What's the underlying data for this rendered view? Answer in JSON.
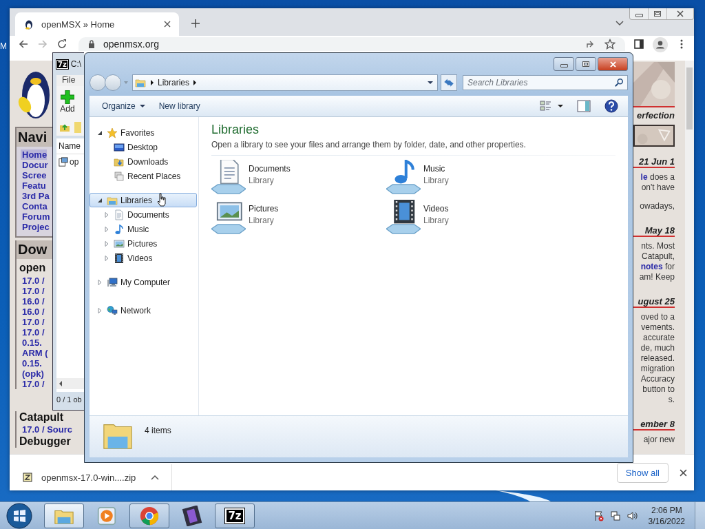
{
  "desktop": {
    "edge_text": "M"
  },
  "browser": {
    "tab": {
      "title": "openMSX » Home",
      "selected": true
    },
    "url": "openmsx.org",
    "page": {
      "nav_heading": "Navi",
      "nav_items": [
        {
          "label": "Home",
          "selected": true
        },
        {
          "label": "Docur",
          "selected": false
        },
        {
          "label": "Scree",
          "selected": false
        },
        {
          "label": "Featu",
          "selected": false
        },
        {
          "label": "3rd Pa",
          "selected": false
        },
        {
          "label": "Conta",
          "selected": false
        },
        {
          "label": "Forum",
          "selected": false
        },
        {
          "label": "Projec",
          "selected": false
        }
      ],
      "download_heading": "Dow",
      "download_subheading": "open",
      "download_links": [
        "17.0 /",
        "17.0 /",
        "16.0 /",
        "16.0 /",
        "17.0 /",
        "17.0 /",
        "0.15.",
        "ARM (",
        "0.15.",
        "(opk)",
        "17.0 /"
      ],
      "lower": [
        {
          "kind": "heading",
          "text": "Catapult"
        },
        {
          "kind": "link",
          "text": "17.0 / Sourc"
        },
        {
          "kind": "heading",
          "text": "Debugger"
        }
      ],
      "banner_text": "erfection",
      "news": [
        {
          "date": "21 Jun 1",
          "paragraphs": [
            [
              "**le** does a",
              "on't have"
            ],
            [
              "owadays,"
            ]
          ]
        },
        {
          "date": "May 18",
          "paragraphs": [
            [
              "nts. Most",
              "Catapult,",
              "**notes** for",
              "am! Keep"
            ]
          ]
        },
        {
          "date": "ugust 25",
          "paragraphs": [
            [
              "oved to a",
              "vements.",
              "accurate",
              "de, much",
              "released.",
              "migration",
              "Accuracy",
              "button to",
              "s."
            ]
          ]
        },
        {
          "date": "ember 8",
          "paragraphs": [
            [
              "ajor new"
            ]
          ]
        }
      ]
    },
    "download_bar": {
      "file": "openmsx-17.0-win....zip",
      "show_all": "Show all"
    }
  },
  "archiver": {
    "logo": "7z",
    "title": "C:\\",
    "menu": [
      "File"
    ],
    "toolbar": [
      "Add"
    ],
    "column": "Name",
    "row": "op",
    "status": "0 / 1 ob"
  },
  "explorer": {
    "breadcrumb": [
      "Libraries"
    ],
    "search": {
      "placeholder": "Search Libraries"
    },
    "commands": [
      {
        "label": "Organize",
        "dropdown": true
      },
      {
        "label": "New library",
        "dropdown": false
      }
    ],
    "tree": [
      {
        "label": "Favorites",
        "kind": "star",
        "expanded": true,
        "selected": false,
        "children": [
          {
            "label": "Desktop",
            "kind": "desktop",
            "selected": false
          },
          {
            "label": "Downloads",
            "kind": "downloads",
            "selected": false
          },
          {
            "label": "Recent Places",
            "kind": "recent",
            "selected": false
          }
        ]
      },
      {
        "label": "Libraries",
        "kind": "libraries",
        "expanded": true,
        "selected": true,
        "children": [
          {
            "label": "Documents",
            "kind": "documents",
            "expanded": false,
            "selected": false
          },
          {
            "label": "Music",
            "kind": "music",
            "expanded": false,
            "selected": false
          },
          {
            "label": "Pictures",
            "kind": "pictures",
            "expanded": false,
            "selected": false
          },
          {
            "label": "Videos",
            "kind": "videos",
            "expanded": false,
            "selected": false
          }
        ]
      },
      {
        "label": "My Computer",
        "kind": "computer",
        "expanded": false,
        "selected": false
      },
      {
        "label": "Network",
        "kind": "network",
        "expanded": false,
        "selected": false
      }
    ],
    "heading": "Libraries",
    "description": "Open a library to see your files and arrange them by folder, date, and other properties.",
    "items": [
      {
        "name": "Documents",
        "type": "Library",
        "kind": "documents"
      },
      {
        "name": "Music",
        "type": "Library",
        "kind": "music"
      },
      {
        "name": "Pictures",
        "type": "Library",
        "kind": "pictures"
      },
      {
        "name": "Videos",
        "type": "Library",
        "kind": "videos"
      }
    ],
    "status": "4 items"
  },
  "taskbar": {
    "buttons": [
      {
        "kind": "explorer",
        "open": true,
        "selected": true
      },
      {
        "kind": "media",
        "open": false,
        "selected": false
      },
      {
        "kind": "chrome",
        "open": true,
        "selected": false
      },
      {
        "kind": "film",
        "open": false,
        "selected": false
      },
      {
        "kind": "archiver",
        "open": true,
        "selected": false,
        "label": "7z"
      }
    ],
    "time": "2:06 PM",
    "date": "3/16/2022"
  }
}
